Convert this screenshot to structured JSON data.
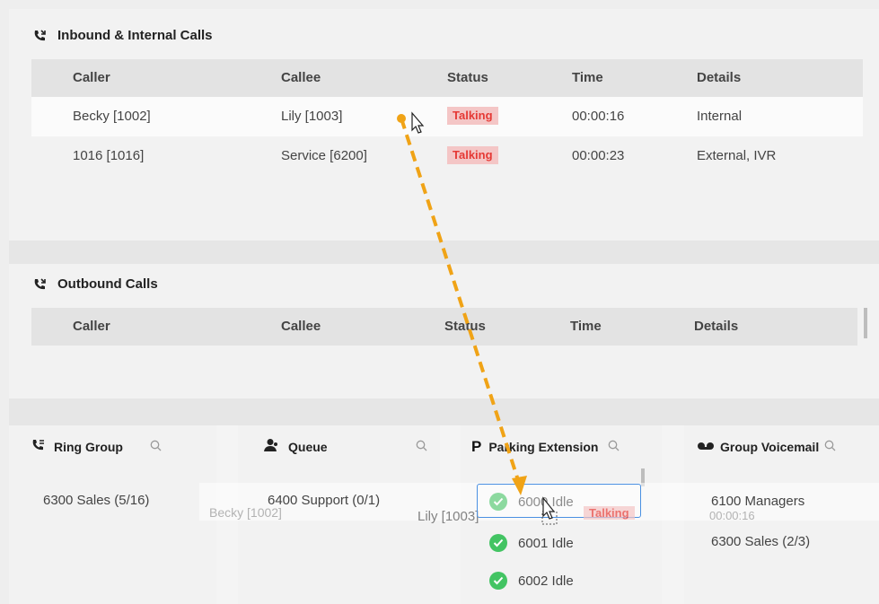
{
  "inbound": {
    "title": "Inbound & Internal Calls",
    "columns": [
      "Caller",
      "Callee",
      "Status",
      "Time",
      "Details"
    ],
    "rows": [
      {
        "caller": "Becky [1002]",
        "callee": "Lily [1003]",
        "status": "Talking",
        "time": "00:00:16",
        "details": "Internal"
      },
      {
        "caller": "1016 [1016]",
        "callee": "Service [6200]",
        "status": "Talking",
        "time": "00:00:23",
        "details": "External, IVR"
      }
    ]
  },
  "outbound": {
    "title": "Outbound Calls",
    "columns": [
      "Caller",
      "Callee",
      "Status",
      "Time",
      "Details"
    ]
  },
  "ring_group": {
    "title": "Ring Group",
    "items": [
      "6300 Sales (5/16)"
    ]
  },
  "queue": {
    "title": "Queue",
    "items": [
      "6400 Support (0/1)"
    ]
  },
  "parking": {
    "title": "Parking Extension",
    "items": [
      {
        "label": "6000 Idle"
      },
      {
        "label": "6001 Idle"
      },
      {
        "label": "6002 Idle"
      }
    ]
  },
  "group_voicemail": {
    "title": "Group Voicemail",
    "items": [
      "6100 Managers",
      "6300 Sales (2/3)"
    ]
  },
  "drag_ghost": {
    "caller": "Becky [1002]",
    "callee": "Lily [1003]",
    "status": "Talking",
    "time": "00:00:16"
  },
  "colors": {
    "accent": "#f0a316",
    "talking_bg": "#f4c6c6",
    "talking_text": "#e53935",
    "idle": "#43c463",
    "drop_border": "#4a90e2"
  }
}
